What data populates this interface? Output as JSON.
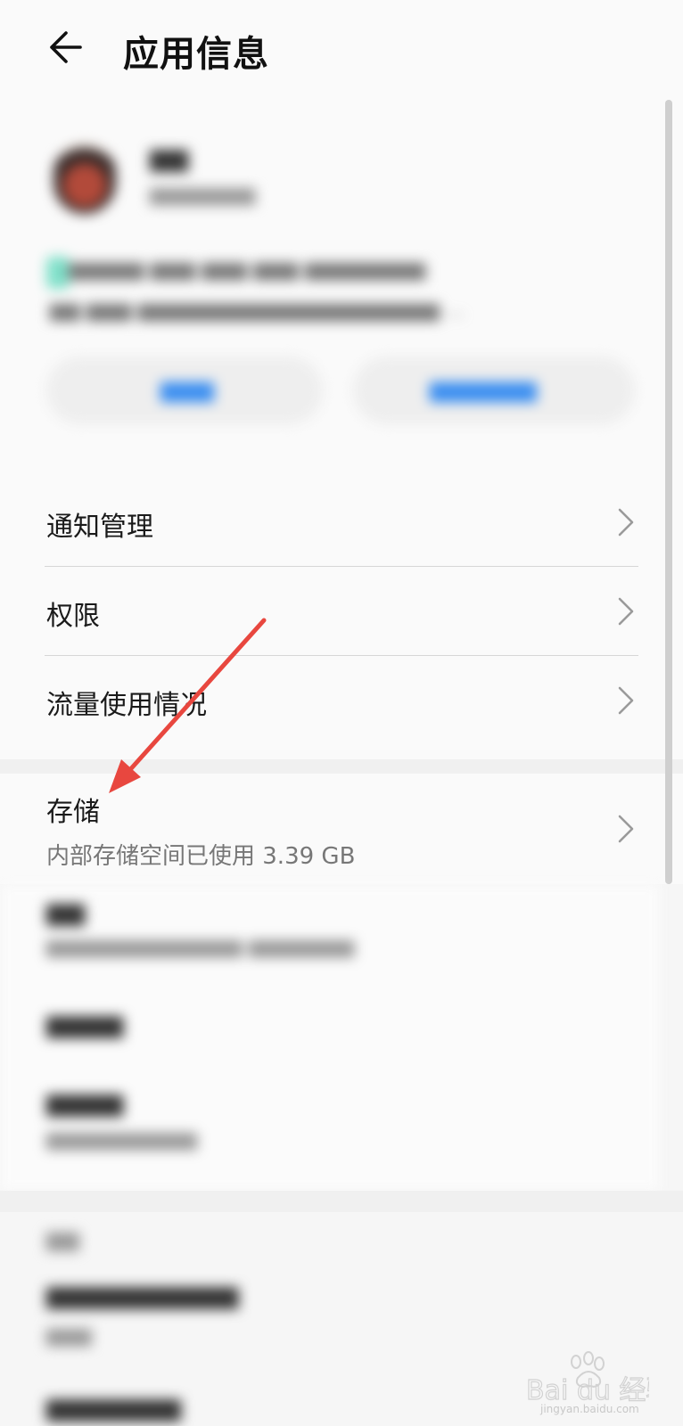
{
  "header": {
    "title": "应用信息",
    "back_icon": "arrow-left-icon"
  },
  "settings": {
    "items": [
      {
        "label": "通知管理"
      },
      {
        "label": "权限"
      },
      {
        "label": "流量使用情况"
      }
    ],
    "storage": {
      "label": "存储",
      "subtitle": "内部存储空间已使用 3.39 GB"
    }
  },
  "annotation": {
    "arrow_color": "#e8473f"
  },
  "watermark": {
    "logo_text": "Bai du 经验",
    "url": "jingyan.baidu.com"
  },
  "colors": {
    "accent": "#3a8ef0",
    "background": "#fafafa",
    "divider": "#d6d6d6"
  }
}
